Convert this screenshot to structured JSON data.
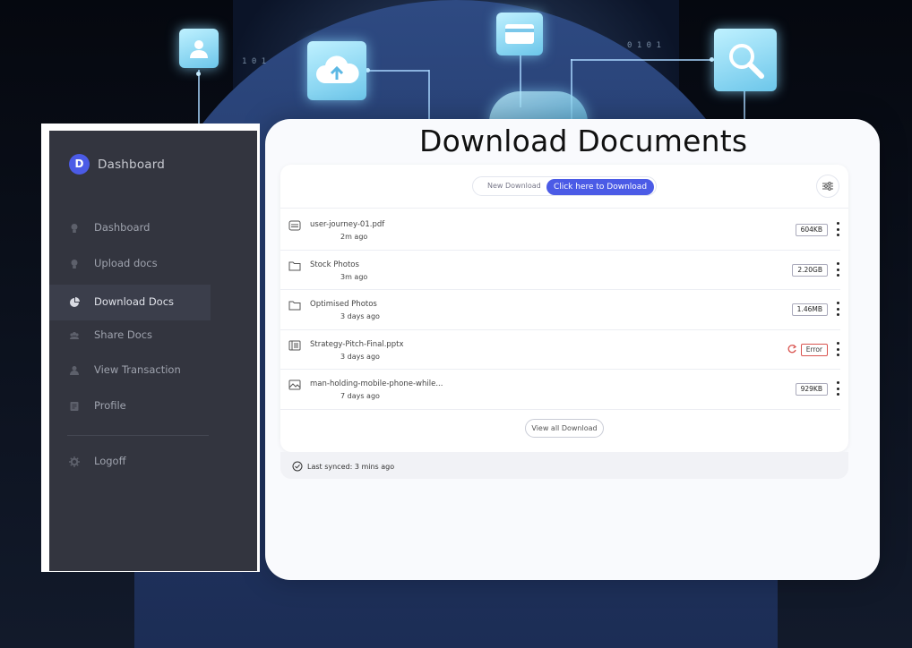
{
  "page": {
    "title": "Download Documents"
  },
  "sidebar": {
    "brand": {
      "logo_letter": "D",
      "label": "Dashboard"
    },
    "items": [
      {
        "label": "Dashboard",
        "icon": "bulb-icon",
        "active": false
      },
      {
        "label": "Upload docs",
        "icon": "bulb-icon",
        "active": false
      },
      {
        "label": "Download Docs",
        "icon": "pie-chart-icon",
        "active": true
      },
      {
        "label": "Share Docs",
        "icon": "users-icon",
        "active": false
      },
      {
        "label": "View Transaction",
        "icon": "user-icon",
        "active": false
      },
      {
        "label": "Profile",
        "icon": "id-card-icon",
        "active": false
      }
    ],
    "logoff": {
      "label": "Logoff",
      "icon": "gear-icon"
    }
  },
  "tabs": {
    "new_download": "New Download",
    "click_to_download": "Click here to Download"
  },
  "files": [
    {
      "name": "user-journey-01.pdf",
      "time": "2m ago",
      "size": "604KB",
      "icon": "pdf-file-icon",
      "status": "ok"
    },
    {
      "name": "Stock Photos",
      "time": "3m ago",
      "size": "2.20GB",
      "icon": "folder-icon",
      "status": "ok"
    },
    {
      "name": "Optimised Photos",
      "time": "3 days ago",
      "size": "1.46MB",
      "icon": "folder-icon",
      "status": "ok"
    },
    {
      "name": "Strategy-Pitch-Final.pptx",
      "time": "3 days ago",
      "size": "Error",
      "icon": "presentation-file-icon",
      "status": "error"
    },
    {
      "name": "man-holding-mobile-phone-while...",
      "time": "7 days ago",
      "size": "929KB",
      "icon": "image-file-icon",
      "status": "ok"
    }
  ],
  "view_all_label": "View all Download",
  "sync_status": "Last synced: 3 mins ago",
  "colors": {
    "accent": "#4b5be6",
    "sidebar_bg": "#33353f",
    "error": "#d9534f"
  }
}
